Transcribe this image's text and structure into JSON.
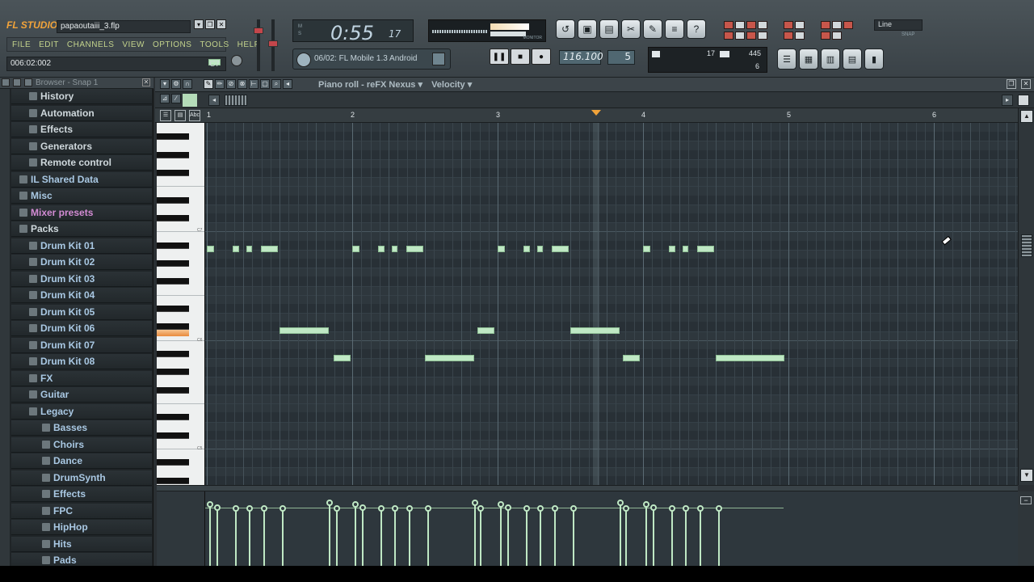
{
  "app": {
    "logo": "FL STUDIO",
    "filename": "papaoutaiii_3.flp",
    "menu": [
      "FILE",
      "EDIT",
      "CHANNELS",
      "VIEW",
      "OPTIONS",
      "TOOLS",
      "HELP"
    ],
    "position": "006:02:002",
    "hint_note": "C7"
  },
  "transport": {
    "time_main": "0:55",
    "time_frac": "17",
    "time_labels": "M\nS",
    "pattern": "06/02: FL Mobile 1.3 Android",
    "tempo": "116.100",
    "pattern_number": "5",
    "cpu_value": "17",
    "ram_value": "445",
    "poly_value": "6",
    "monitor_label": "MONITOR",
    "snap": "Line",
    "snap_label": "SNAP"
  },
  "browser": {
    "title": "Browser - Snap 1",
    "items": [
      {
        "label": "History",
        "style": "normal"
      },
      {
        "label": "Automation",
        "style": "normal"
      },
      {
        "label": "Effects",
        "style": "normal"
      },
      {
        "label": "Generators",
        "style": "normal"
      },
      {
        "label": "Remote control",
        "style": "normal"
      },
      {
        "label": "IL Shared Data",
        "style": "blue"
      },
      {
        "label": "Misc",
        "style": "blue"
      },
      {
        "label": "Mixer presets",
        "style": "pink"
      },
      {
        "label": "Packs",
        "style": "normal"
      },
      {
        "label": "Drum Kit 01",
        "style": "blue"
      },
      {
        "label": "Drum Kit 02",
        "style": "blue"
      },
      {
        "label": "Drum Kit 03",
        "style": "blue"
      },
      {
        "label": "Drum Kit 04",
        "style": "blue"
      },
      {
        "label": "Drum Kit 05",
        "style": "blue"
      },
      {
        "label": "Drum Kit 06",
        "style": "blue"
      },
      {
        "label": "Drum Kit 07",
        "style": "blue"
      },
      {
        "label": "Drum Kit 08",
        "style": "blue"
      },
      {
        "label": "FX",
        "style": "blue"
      },
      {
        "label": "Guitar",
        "style": "blue"
      },
      {
        "label": "Legacy",
        "style": "blue"
      },
      {
        "label": "Basses",
        "style": "blue"
      },
      {
        "label": "Choirs",
        "style": "blue"
      },
      {
        "label": "Dance",
        "style": "blue"
      },
      {
        "label": "DrumSynth",
        "style": "blue"
      },
      {
        "label": "Effects",
        "style": "blue"
      },
      {
        "label": "FPC",
        "style": "blue"
      },
      {
        "label": "HipHop",
        "style": "blue"
      },
      {
        "label": "Hits",
        "style": "blue"
      },
      {
        "label": "Pads",
        "style": "blue"
      }
    ]
  },
  "piano_roll": {
    "title": "Piano roll - reFX Nexus",
    "target": "Velocity",
    "bars": [
      "1",
      "2",
      "3",
      "4",
      "5",
      "6"
    ],
    "key_labels": [
      "C7",
      "C6",
      "C5"
    ],
    "playhead_bar": 3.68,
    "note_color": "#bfe8c4",
    "notes": [
      {
        "row": 0,
        "start": 0.0,
        "len": 0.05
      },
      {
        "row": 0,
        "start": 0.18,
        "len": 0.04
      },
      {
        "row": 0,
        "start": 0.27,
        "len": 0.04
      },
      {
        "row": 0,
        "start": 0.37,
        "len": 0.12
      },
      {
        "row": 0,
        "start": 1.0,
        "len": 0.05
      },
      {
        "row": 0,
        "start": 1.18,
        "len": 0.04
      },
      {
        "row": 0,
        "start": 1.27,
        "len": 0.04
      },
      {
        "row": 0,
        "start": 1.37,
        "len": 0.12
      },
      {
        "row": 0,
        "start": 2.0,
        "len": 0.05
      },
      {
        "row": 0,
        "start": 2.18,
        "len": 0.04
      },
      {
        "row": 0,
        "start": 2.27,
        "len": 0.04
      },
      {
        "row": 0,
        "start": 2.37,
        "len": 0.12
      },
      {
        "row": 0,
        "start": 3.0,
        "len": 0.05
      },
      {
        "row": 0,
        "start": 3.18,
        "len": 0.04
      },
      {
        "row": 0,
        "start": 3.27,
        "len": 0.04
      },
      {
        "row": 0,
        "start": 3.37,
        "len": 0.12
      },
      {
        "row": 1,
        "start": 0.5,
        "len": 0.34
      },
      {
        "row": 1,
        "start": 1.86,
        "len": 0.12
      },
      {
        "row": 1,
        "start": 2.5,
        "len": 0.34
      },
      {
        "row": 2,
        "start": 0.87,
        "len": 0.12
      },
      {
        "row": 2,
        "start": 1.5,
        "len": 0.34
      },
      {
        "row": 2,
        "start": 2.86,
        "len": 0.12
      },
      {
        "row": 2,
        "start": 3.5,
        "len": 0.47
      }
    ],
    "velocities": [
      {
        "x": 0.0,
        "v": 0.83
      },
      {
        "x": 0.05,
        "v": 0.78
      },
      {
        "x": 0.18,
        "v": 0.77
      },
      {
        "x": 0.27,
        "v": 0.77
      },
      {
        "x": 0.37,
        "v": 0.77
      },
      {
        "x": 0.5,
        "v": 0.77
      },
      {
        "x": 0.82,
        "v": 0.85
      },
      {
        "x": 0.87,
        "v": 0.77
      },
      {
        "x": 1.0,
        "v": 0.83
      },
      {
        "x": 1.05,
        "v": 0.78
      },
      {
        "x": 1.18,
        "v": 0.77
      },
      {
        "x": 1.27,
        "v": 0.77
      },
      {
        "x": 1.37,
        "v": 0.77
      },
      {
        "x": 1.5,
        "v": 0.77
      },
      {
        "x": 1.82,
        "v": 0.85
      },
      {
        "x": 1.86,
        "v": 0.77
      },
      {
        "x": 2.0,
        "v": 0.83
      },
      {
        "x": 2.05,
        "v": 0.78
      },
      {
        "x": 2.18,
        "v": 0.77
      },
      {
        "x": 2.27,
        "v": 0.77
      },
      {
        "x": 2.37,
        "v": 0.77
      },
      {
        "x": 2.5,
        "v": 0.77
      },
      {
        "x": 2.82,
        "v": 0.85
      },
      {
        "x": 2.86,
        "v": 0.77
      },
      {
        "x": 3.0,
        "v": 0.83
      },
      {
        "x": 3.05,
        "v": 0.78
      },
      {
        "x": 3.18,
        "v": 0.77
      },
      {
        "x": 3.27,
        "v": 0.77
      },
      {
        "x": 3.37,
        "v": 0.77
      },
      {
        "x": 3.5,
        "v": 0.77
      }
    ]
  }
}
